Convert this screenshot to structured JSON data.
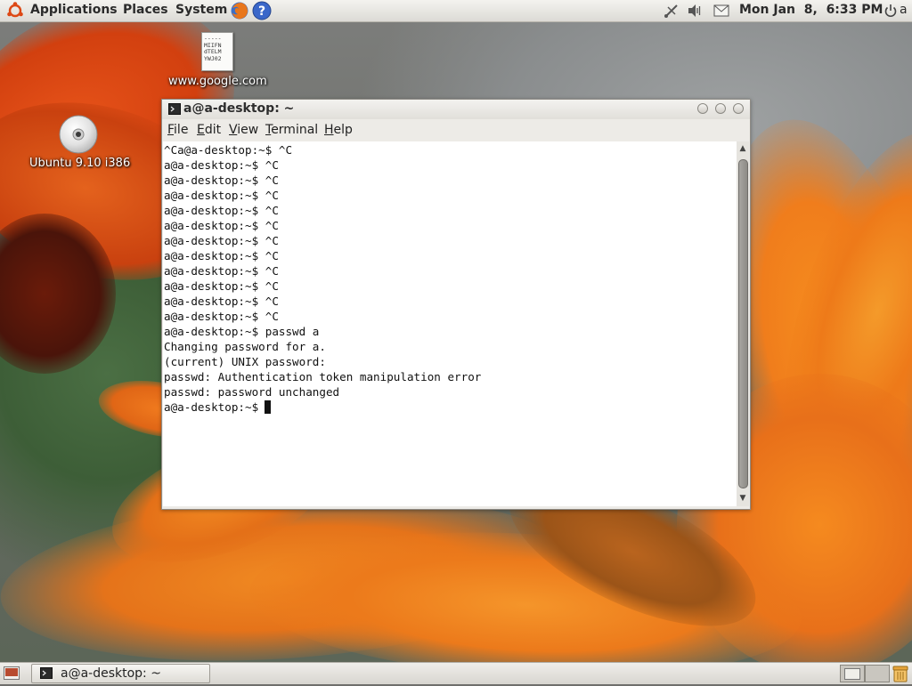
{
  "top_panel": {
    "menus": [
      "Applications",
      "Places",
      "System"
    ],
    "clock": "Mon Jan  8,  6:33 PM",
    "user": "a"
  },
  "desktop": {
    "icons": [
      {
        "label": "www.google.com",
        "file_preview": [
          "-----",
          "MIIFN",
          "dTELM",
          "YWJ02"
        ]
      },
      {
        "label": "Ubuntu 9.10 i386"
      }
    ]
  },
  "terminal": {
    "title": "a@a-desktop: ~",
    "menu": [
      {
        "underline": "F",
        "rest": "ile"
      },
      {
        "underline": "E",
        "rest": "dit"
      },
      {
        "underline": "V",
        "rest": "iew"
      },
      {
        "underline": "T",
        "rest": "erminal"
      },
      {
        "underline": "H",
        "rest": "elp"
      }
    ],
    "lines": [
      "^Ca@a-desktop:~$ ^C",
      "a@a-desktop:~$ ^C",
      "a@a-desktop:~$ ^C",
      "a@a-desktop:~$ ^C",
      "a@a-desktop:~$ ^C",
      "a@a-desktop:~$ ^C",
      "a@a-desktop:~$ ^C",
      "a@a-desktop:~$ ^C",
      "a@a-desktop:~$ ^C",
      "a@a-desktop:~$ ^C",
      "a@a-desktop:~$ ^C",
      "a@a-desktop:~$ ^C",
      "a@a-desktop:~$ passwd a",
      "Changing password for a.",
      "(current) UNIX password:",
      "passwd: Authentication token manipulation error",
      "passwd: password unchanged"
    ],
    "prompt": "a@a-desktop:~$"
  },
  "taskbar": {
    "window_label": "a@a-desktop: ~"
  },
  "colors": {
    "panel": "#dcdad5",
    "ubuntu_orange": "#dd4814",
    "petal_orange": "#f07d1c"
  }
}
